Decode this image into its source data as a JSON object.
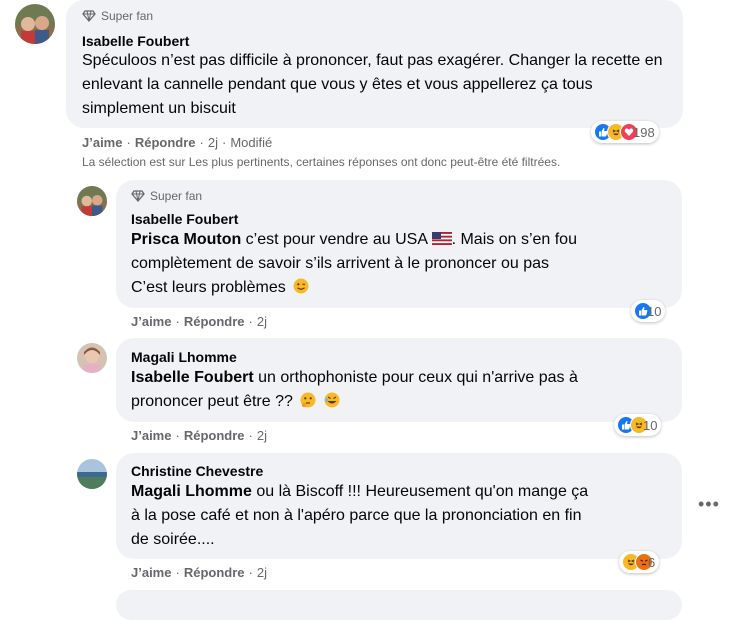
{
  "comments": [
    {
      "badge": "Super fan",
      "author": "Isabelle Foubert",
      "mention": "",
      "text": "Spéculoos n’est pas difficile à prononcer, faut pas exagérer. Changer la recette en enlevant la cannelle pendant que vous y êtes et vous appellerez ça tous simplement un biscuit",
      "like_label": "J’aime",
      "reply_label": "Répondre",
      "time": "2j",
      "edited": "Modifié",
      "reactions": [
        "like",
        "haha",
        "love"
      ],
      "reaction_count": "198"
    }
  ],
  "filter_notice": "La sélection est sur Les plus pertinents, certaines réponses ont donc peut-être été filtrées.",
  "replies": [
    {
      "badge": "Super fan",
      "author": "Isabelle Foubert",
      "mention": "Prisca Mouton",
      "text_line1": " c’est pour vendre au USA",
      "text_line1b": ". Mais on s’en fou",
      "text_line2": "complètement de savoir s’ils arrivent à le prononcer ou pas",
      "text_line3": "C’est leurs problèmes",
      "like_label": "J’aime",
      "reply_label": "Répondre",
      "time": "2j",
      "reactions": [
        "like"
      ],
      "reaction_count": "10"
    },
    {
      "badge": "",
      "author": "Magali Lhomme",
      "mention": "Isabelle Foubert",
      "text_line1": " un orthophoniste pour ceux qui n'arrive pas à",
      "text_line2": "prononcer peut être ??",
      "like_label": "J’aime",
      "reply_label": "Répondre",
      "time": "2j",
      "reactions": [
        "like",
        "haha"
      ],
      "reaction_count": "10"
    },
    {
      "badge": "",
      "author": "Christine Chevestre",
      "mention": "Magali Lhomme",
      "text_line1": " ou là Biscoff !!! Heureusement qu'on mange ça",
      "text_line2": "à la pose café et non à l'apéro parce que la prononciation en fin",
      "text_line3": "de soirée....",
      "like_label": "J’aime",
      "reply_label": "Répondre",
      "time": "2j",
      "reactions": [
        "haha",
        "angry"
      ],
      "reaction_count": "6"
    }
  ],
  "more_menu": "•••",
  "colors": {
    "bubble": "#f0f2f5",
    "meta": "#65676b",
    "like": "#1877f2"
  }
}
